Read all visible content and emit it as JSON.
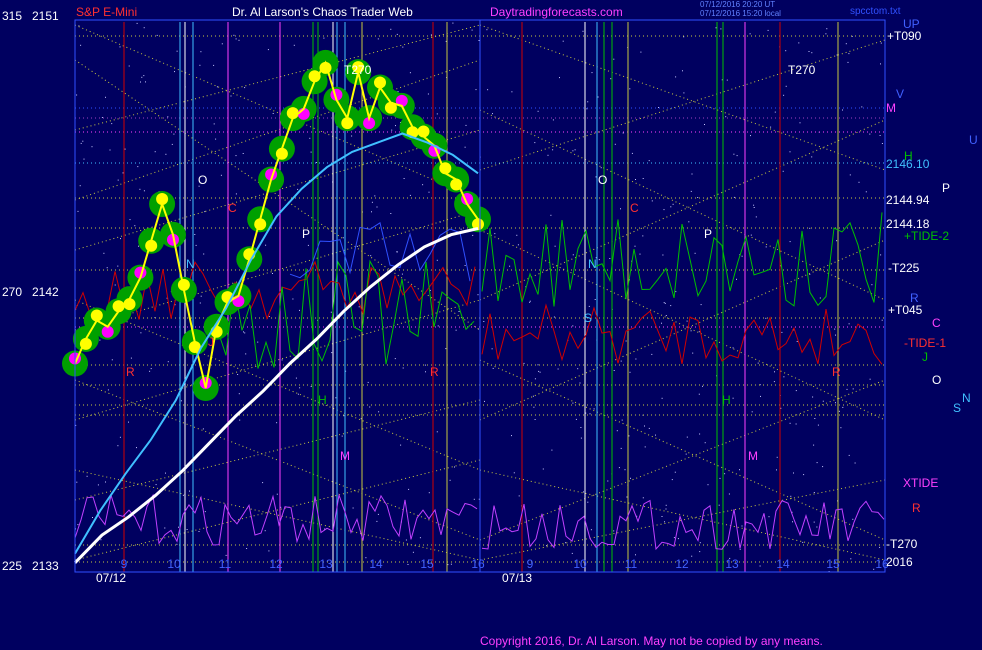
{
  "header": {
    "left_price_code": "315",
    "left_price": "2151",
    "instrument": "S&P E-Mini",
    "site_title": "Dr. Al Larson's Chaos Trader Web",
    "site_link": "Daytradingforecasts.com",
    "timestamp_line1": "07/12/2016 20:20 UT",
    "timestamp_line2": "07/12/2016 15:20 local",
    "corner_file": "spcctom.txt"
  },
  "footer": {
    "copyright": "Copyright 2016, Dr. Al Larson. May not be copied by any means."
  },
  "colors": {
    "background": "#000060",
    "price_yellow": "#ffff00",
    "halo_green": "#00a000",
    "magenta": "#ff00ff",
    "cyan": "#40c0ff",
    "white": "#ffffff",
    "red": "#d00000",
    "green": "#00c000",
    "blue": "#4060ff",
    "dotted_yellow": "#d0d040"
  },
  "chart_data": {
    "type": "line",
    "y_axis_left": [
      {
        "code": "315",
        "price": "2151"
      },
      {
        "code": "270",
        "price": "2142"
      },
      {
        "code": "225",
        "price": "2133"
      }
    ],
    "ylim": [
      2133,
      2151
    ],
    "x_dates": [
      "07/12",
      "07/13"
    ],
    "x_hours_day1": [
      "9",
      "10",
      "11",
      "12",
      "13",
      "14",
      "15",
      "16"
    ],
    "x_hours_day2": [
      "9",
      "10",
      "11",
      "12",
      "13",
      "14",
      "15",
      "16"
    ],
    "right_labels": [
      {
        "text": "UP",
        "color": "#4060ff"
      },
      {
        "text": "+T090",
        "color": "#ffffff"
      },
      {
        "text": "V",
        "color": "#4060ff"
      },
      {
        "text": "M",
        "color": "#ff40ff"
      },
      {
        "text": "U",
        "color": "#4060ff"
      },
      {
        "text": "H",
        "color": "#00c000"
      },
      {
        "text": "2146.10",
        "color": "#40c0ff"
      },
      {
        "text": "P",
        "color": "#ffffff"
      },
      {
        "text": "2144.94",
        "color": "#ffffff"
      },
      {
        "text": "2144.18",
        "color": "#ffffff"
      },
      {
        "text": "+TIDE-2",
        "color": "#00c000"
      },
      {
        "text": "-T225",
        "color": "#ffffff"
      },
      {
        "text": "R",
        "color": "#4060ff"
      },
      {
        "text": "+T045",
        "color": "#ffffff"
      },
      {
        "text": "C",
        "color": "#ff40ff"
      },
      {
        "text": "-TIDE-1",
        "color": "#ff3030"
      },
      {
        "text": "J",
        "color": "#00c000"
      },
      {
        "text": "O",
        "color": "#ffffff"
      },
      {
        "text": "N",
        "color": "#40c0ff"
      },
      {
        "text": "S",
        "color": "#40c0ff"
      },
      {
        "text": "XTIDE",
        "color": "#ff40ff"
      },
      {
        "text": "R",
        "color": "#ff3030"
      },
      {
        "text": "-T270",
        "color": "#ffffff"
      },
      {
        "text": "2016",
        "color": "#ffffff"
      }
    ],
    "plot_labels": [
      {
        "text": "T270",
        "color": "#ffffff"
      },
      {
        "text": "T270",
        "color": "#ffffff"
      },
      {
        "text": "O",
        "color": "#ffffff"
      },
      {
        "text": "O",
        "color": "#ffffff"
      },
      {
        "text": "C",
        "color": "#ff3030"
      },
      {
        "text": "C",
        "color": "#ff3030"
      },
      {
        "text": "N",
        "color": "#40c0ff"
      },
      {
        "text": "N",
        "color": "#40c0ff"
      },
      {
        "text": "P",
        "color": "#ffffff"
      },
      {
        "text": "P",
        "color": "#ffffff"
      },
      {
        "text": "S",
        "color": "#40c0ff"
      },
      {
        "text": "J",
        "color": "#ff3030"
      },
      {
        "text": "R",
        "color": "#ff3030"
      },
      {
        "text": "R",
        "color": "#ff3030"
      },
      {
        "text": "R",
        "color": "#ff3030"
      },
      {
        "text": "H",
        "color": "#00c000"
      },
      {
        "text": "H",
        "color": "#00c000"
      },
      {
        "text": "M",
        "color": "#ff40ff"
      },
      {
        "text": "M",
        "color": "#ff40ff"
      }
    ],
    "series": [
      {
        "name": "price",
        "color": "#ffff00",
        "values": [
          2139.8,
          2140.6,
          2141.2,
          2141.0,
          2141.5,
          2141.9,
          2142.6,
          2143.8,
          2145.0,
          2144.0,
          2142.2,
          2140.5,
          2139.0,
          2141.0,
          2141.8,
          2142.0,
          2143.2,
          2144.5,
          2145.8,
          2146.8,
          2147.8,
          2148.1,
          2149.0,
          2149.6,
          2148.4,
          2147.8,
          2149.3,
          2147.8,
          2148.8,
          2148.3,
          2148.2,
          2147.5,
          2147.2,
          2146.9,
          2146.0,
          2145.8,
          2145.0,
          2144.5
        ]
      },
      {
        "name": "slow average",
        "color": "#ffffff",
        "values": [
          2133.3,
          2134.2,
          2134.8,
          2135.5,
          2136.3,
          2137.2,
          2138.1,
          2138.9,
          2139.8,
          2140.6,
          2141.5,
          2142.3,
          2143.0,
          2143.6,
          2144.0,
          2144.2
        ]
      },
      {
        "name": "fast average",
        "color": "#40c0ff",
        "values": [
          2133.6,
          2135.0,
          2136.2,
          2137.3,
          2138.6,
          2140.3,
          2141.6,
          2143.2,
          2144.6,
          2145.5,
          2146.2,
          2146.7,
          2147.0,
          2147.3,
          2147.0,
          2146.6,
          2146.0
        ]
      }
    ]
  }
}
